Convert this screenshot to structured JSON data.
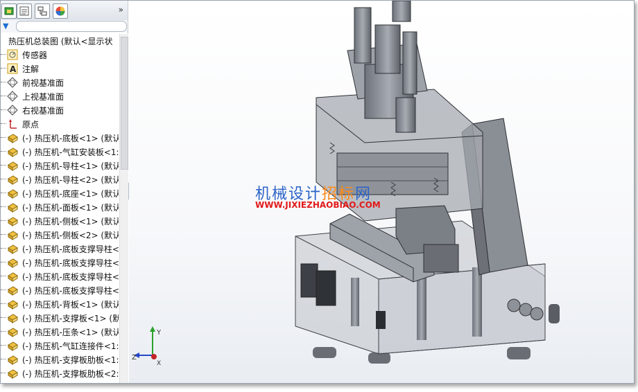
{
  "toolbar": {
    "icons": [
      "part-tree-icon",
      "property-manager-icon",
      "configuration-icon",
      "appearance-icon"
    ],
    "more": "»"
  },
  "filter": {
    "icon": "▼"
  },
  "tree": {
    "root": "热压机总装图  (默认<显示状",
    "items": [
      {
        "icon": "sensor-icon",
        "label": "传感器"
      },
      {
        "icon": "annotation-icon",
        "label": "注解"
      },
      {
        "icon": "plane-icon",
        "label": "前视基准面"
      },
      {
        "icon": "plane-icon",
        "label": "上视基准面"
      },
      {
        "icon": "plane-icon",
        "label": "右视基准面"
      },
      {
        "icon": "origin-icon",
        "label": "原点"
      },
      {
        "icon": "part-icon",
        "label": "(-) 热压机-底板<1> (默认"
      },
      {
        "icon": "part-icon",
        "label": "(-) 热压机-气缸安装板<1:"
      },
      {
        "icon": "part-icon",
        "label": "(-) 热压机-导柱<1> (默认"
      },
      {
        "icon": "part-icon",
        "label": "(-) 热压机-导柱<2> (默认"
      },
      {
        "icon": "part-icon",
        "label": "(-) 热压机-底座<1> (默认"
      },
      {
        "icon": "part-icon",
        "label": "(-) 热压机-面板<1> (默认"
      },
      {
        "icon": "part-icon",
        "label": "(-) 热压机-侧板<1> (默认"
      },
      {
        "icon": "part-icon",
        "label": "(-) 热压机-侧板<2> (默认"
      },
      {
        "icon": "part-icon",
        "label": "(-) 热压机-底板支撑导柱<"
      },
      {
        "icon": "part-icon",
        "label": "(-) 热压机-底板支撑导柱<"
      },
      {
        "icon": "part-icon",
        "label": "(-) 热压机-底板支撑导柱<"
      },
      {
        "icon": "part-icon",
        "label": "(-) 热压机-底板支撑导柱<"
      },
      {
        "icon": "part-icon",
        "label": "(-) 热压机-背板<1> (默认"
      },
      {
        "icon": "part-icon",
        "label": "(-) 热压机-支撑板<1> (默"
      },
      {
        "icon": "part-icon",
        "label": "(-) 热压机-压条<1> (默认"
      },
      {
        "icon": "part-icon",
        "label": "(-) 热压机-气缸连接件<1:"
      },
      {
        "icon": "part-icon",
        "label": "(-) 热压机-支撑板肋板<1:"
      },
      {
        "icon": "part-icon",
        "label": "(-) 热压机-支撑板肋板<2:"
      }
    ]
  },
  "viewport": {
    "watermark_title_a": "机械设计",
    "watermark_title_b": "招标",
    "watermark_title_c": "网",
    "watermark_url": "WWW.JIXIEZHAOBIAO.COM",
    "triad": {
      "x": "X",
      "y": "Y",
      "z": "Z"
    }
  },
  "colors": {
    "part": "#f0c040",
    "model": "#8e9299",
    "accent": "#2b63c8"
  }
}
